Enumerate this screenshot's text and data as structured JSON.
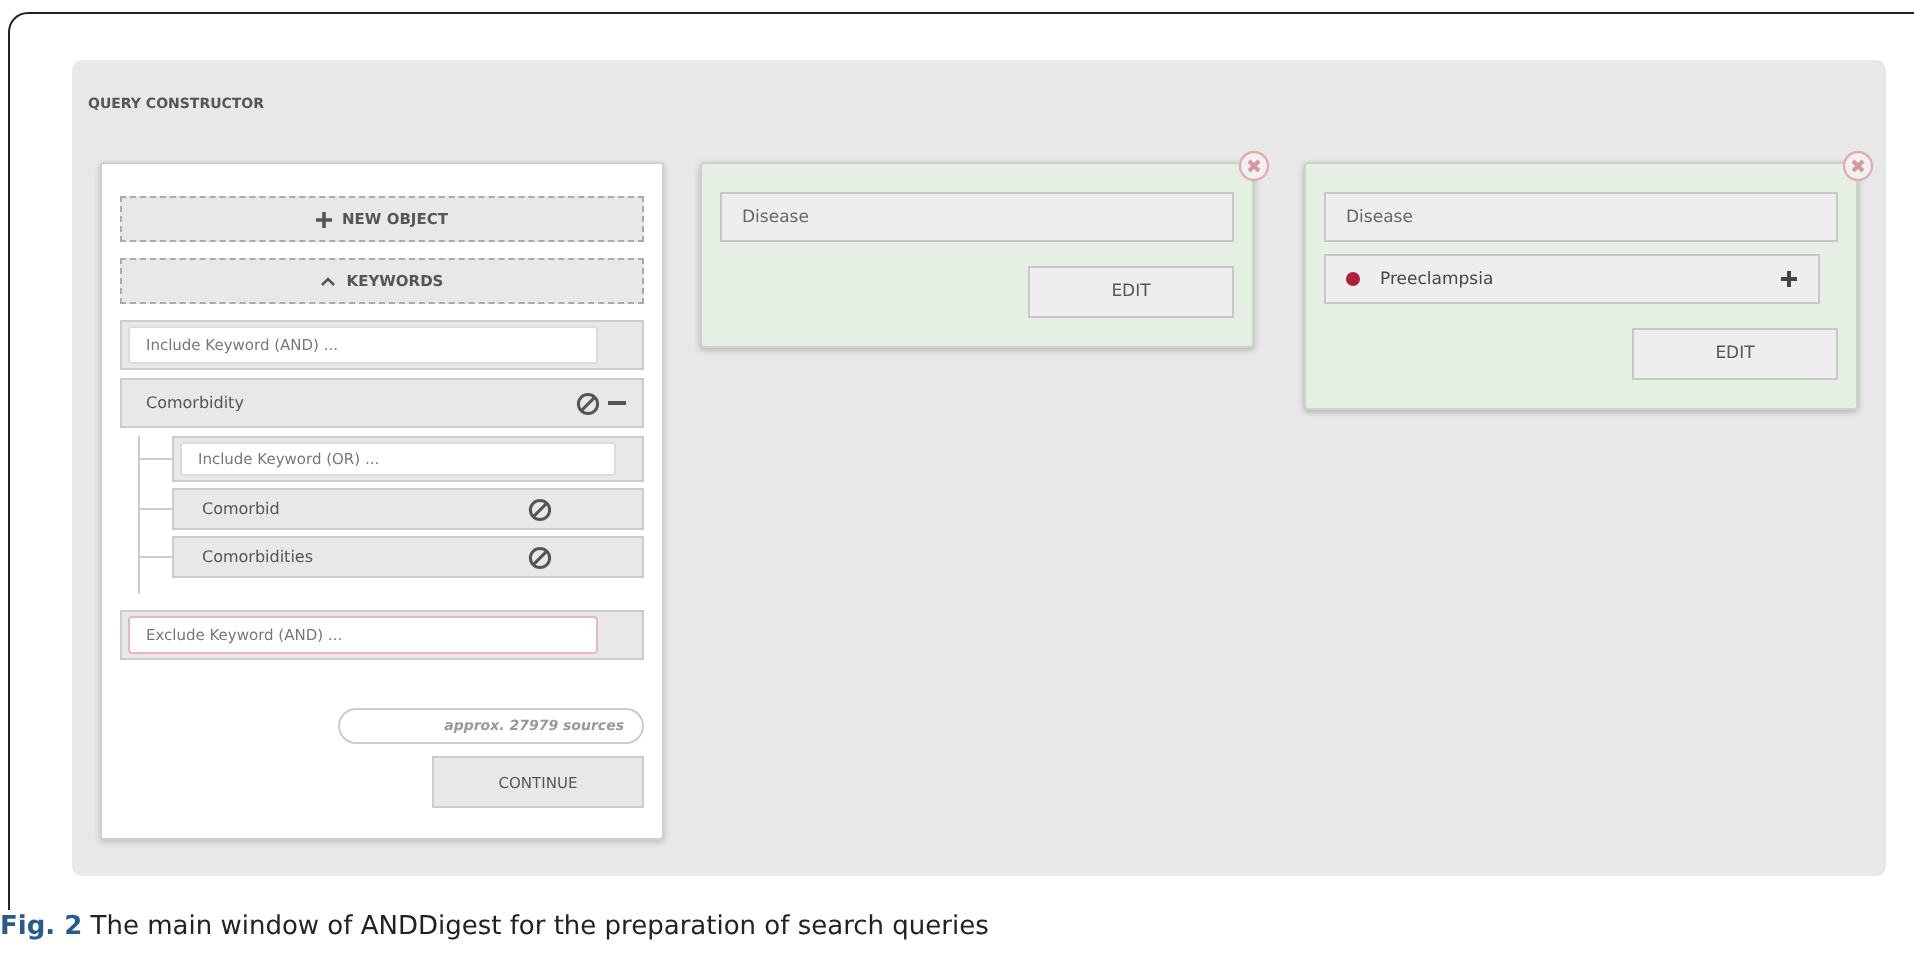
{
  "section_title": "QUERY CONSTRUCTOR",
  "query_panel": {
    "new_object_button": "NEW OBJECT",
    "keywords_button": "KEYWORDS",
    "include_field": {
      "placeholder": "Include Keyword (AND) ..."
    },
    "keyword_groups": [
      {
        "label": "Comorbidity",
        "or_field": {
          "placeholder": "Include Keyword (OR) ..."
        },
        "children": [
          {
            "label": "Comorbid"
          },
          {
            "label": "Comorbidities"
          }
        ]
      }
    ],
    "exclude_field": {
      "placeholder": "Exclude Keyword (AND) ..."
    },
    "source_count": "approx. 27979 sources",
    "continue_button": "CONTINUE"
  },
  "objects": [
    {
      "rows": [
        {
          "kind": "category",
          "text": "Disease"
        }
      ],
      "edit_button": "EDIT"
    },
    {
      "rows": [
        {
          "kind": "category",
          "text": "Disease"
        },
        {
          "kind": "term",
          "text": "Preeclampsia",
          "color": "#b0203e"
        }
      ],
      "edit_button": "EDIT"
    }
  ],
  "caption": "**Fig. 2** The main window of ANDDigest for the preparation of search queries"
}
